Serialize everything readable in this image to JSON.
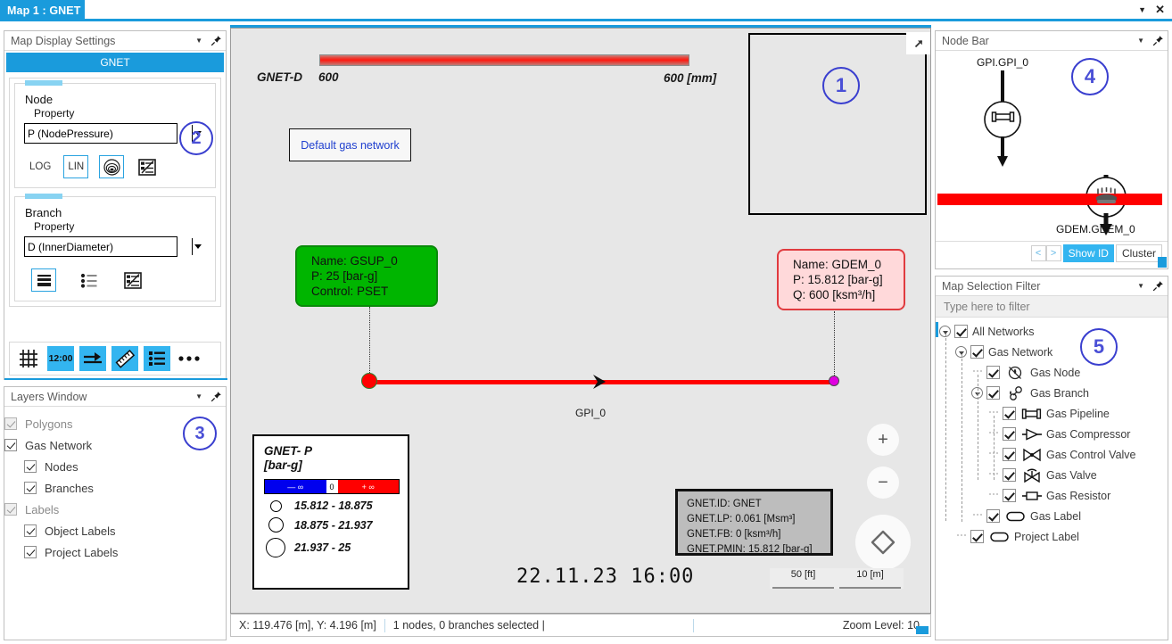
{
  "window": {
    "tab_title": "Map 1 : GNET",
    "dropdown_icon": "chevron-down-icon",
    "close_icon": "close-icon"
  },
  "map_display_settings": {
    "title": "Map Display Settings",
    "network_tab": "GNET",
    "node_group": {
      "title": "Node",
      "sub": "Property",
      "selected": "P (NodePressure)",
      "options": [
        "P (NodePressure)"
      ],
      "log_label": "LOG",
      "lin_label": "LIN",
      "gradient_icon": "contour-gradient-icon",
      "settings_icon": "node-legend-settings-icon"
    },
    "branch_group": {
      "title": "Branch",
      "sub": "Property",
      "selected": "D (InnerDiameter)",
      "options": [
        "D (InnerDiameter)"
      ],
      "thickness_icon": "branch-thickness-icon",
      "list_icon": "branch-list-icon",
      "settings_icon": "branch-legend-settings-icon"
    },
    "toolbar": [
      {
        "name": "grid-icon",
        "label": "",
        "active": false
      },
      {
        "name": "clock-icon",
        "label": "12:00",
        "active": true
      },
      {
        "name": "flow-arrow-icon",
        "label": "",
        "active": true
      },
      {
        "name": "ruler-icon",
        "label": "",
        "active": true
      },
      {
        "name": "legend-list-icon",
        "label": "",
        "active": true
      },
      {
        "name": "more-options-icon",
        "label": "",
        "active": false
      }
    ],
    "badge": "2"
  },
  "layers_window": {
    "title": "Layers Window",
    "badge": "3",
    "items": [
      {
        "label": "Polygons",
        "checked": true,
        "indent": 0,
        "dim": true
      },
      {
        "label": "Gas Network",
        "checked": true,
        "indent": 0,
        "dim": false
      },
      {
        "label": "Nodes",
        "checked": true,
        "indent": 1,
        "dim": false
      },
      {
        "label": "Branches",
        "checked": true,
        "indent": 1,
        "dim": false
      },
      {
        "label": "Labels",
        "checked": true,
        "indent": 0,
        "dim": true
      },
      {
        "label": "Object Labels",
        "checked": true,
        "indent": 1,
        "dim": false
      },
      {
        "label": "Project Labels",
        "checked": true,
        "indent": 1,
        "dim": false
      }
    ]
  },
  "map": {
    "badge_inset": "1",
    "scale_legend": {
      "name": "GNET-D",
      "min": "600",
      "max": "600 [mm]"
    },
    "default_label": "Default gas network",
    "inset_popout_icon": "popout-arrow-icon",
    "inset_symbol_icon": "branch-symbol-icon",
    "supply_node": "Name: GSUP_0\nP: 25 [bar-g]\nControl: PSET",
    "demand_node": "Name: GDEM_0\nP: 15.812 [bar-g]\nQ: 600 [ksm³/h]",
    "branch_label": "GPI_0",
    "legend": {
      "title_line1": "GNET- P",
      "title_line2": "[bar-g]",
      "ramp_min": "— ∞",
      "ramp_zero": "0",
      "ramp_max": "+ ∞",
      "classes": [
        {
          "range": "15.812 - 18.875",
          "size": 13
        },
        {
          "range": "18.875 - 21.937",
          "size": 17
        },
        {
          "range": "21.937 - 25",
          "size": 22
        }
      ]
    },
    "info_box": "GNET.ID: GNET\nGNET.LP: 0.061 [Msm³]\nGNET.FB: 0 [ksm³/h]\nGNET.PMIN: 15.812 [bar-g]",
    "zoom_in_label": "+",
    "zoom_out_label": "−",
    "pan_icon": "pan-compass-icon",
    "datetime": "22.11.23  16:00",
    "scale_ft": "50 [ft]",
    "scale_m": "10 [m]"
  },
  "status_bar": {
    "coords": "X: 119.476 [m], Y: 4.196 [m]",
    "selection": "1 nodes, 0 branches selected  |",
    "zoom_level": "Zoom Level: 10"
  },
  "node_bar": {
    "title": "Node Bar",
    "badge": "4",
    "top_label": "GPI.GPI_0",
    "top_icon": "gas-pipeline-icon",
    "bottom_icon": "gas-demand-icon",
    "bottom_label": "GDEM.GDEM_0",
    "prev_label": "<",
    "next_label": ">",
    "show_id_label": "Show ID",
    "cluster_label": "Cluster"
  },
  "map_selection_filter": {
    "title": "Map Selection Filter",
    "badge": "5",
    "filter_placeholder": "Type here to filter",
    "tree": [
      {
        "label": "All Networks",
        "indent": 0,
        "expander": true,
        "icon": "",
        "checked": true
      },
      {
        "label": "Gas Network",
        "indent": 1,
        "expander": true,
        "icon": "",
        "checked": true
      },
      {
        "label": "Gas Node",
        "indent": 2,
        "expander": false,
        "icon": "gas-node-icon",
        "checked": true
      },
      {
        "label": "Gas Branch",
        "indent": 2,
        "expander": true,
        "icon": "gas-branch-icon",
        "checked": true
      },
      {
        "label": "Gas Pipeline",
        "indent": 3,
        "expander": false,
        "icon": "gas-pipeline-icon",
        "checked": true
      },
      {
        "label": "Gas Compressor",
        "indent": 3,
        "expander": false,
        "icon": "gas-compressor-icon",
        "checked": true
      },
      {
        "label": "Gas Control Valve",
        "indent": 3,
        "expander": false,
        "icon": "gas-control-valve-icon",
        "checked": true
      },
      {
        "label": "Gas Valve",
        "indent": 3,
        "expander": false,
        "icon": "gas-valve-icon",
        "checked": true
      },
      {
        "label": "Gas Resistor",
        "indent": 3,
        "expander": false,
        "icon": "gas-resistor-icon",
        "checked": true
      },
      {
        "label": "Gas Label",
        "indent": 2,
        "expander": false,
        "icon": "gas-label-icon",
        "checked": true
      },
      {
        "label": "Project Label",
        "indent": 1,
        "expander": false,
        "icon": "project-label-icon",
        "checked": true
      }
    ]
  },
  "colors": {
    "accent": "#1a9bdc",
    "badge": "#4a4fd6",
    "pipe_red": "#ff0000",
    "supply_green": "#00b500",
    "demand_pink": "#ffd9da"
  }
}
